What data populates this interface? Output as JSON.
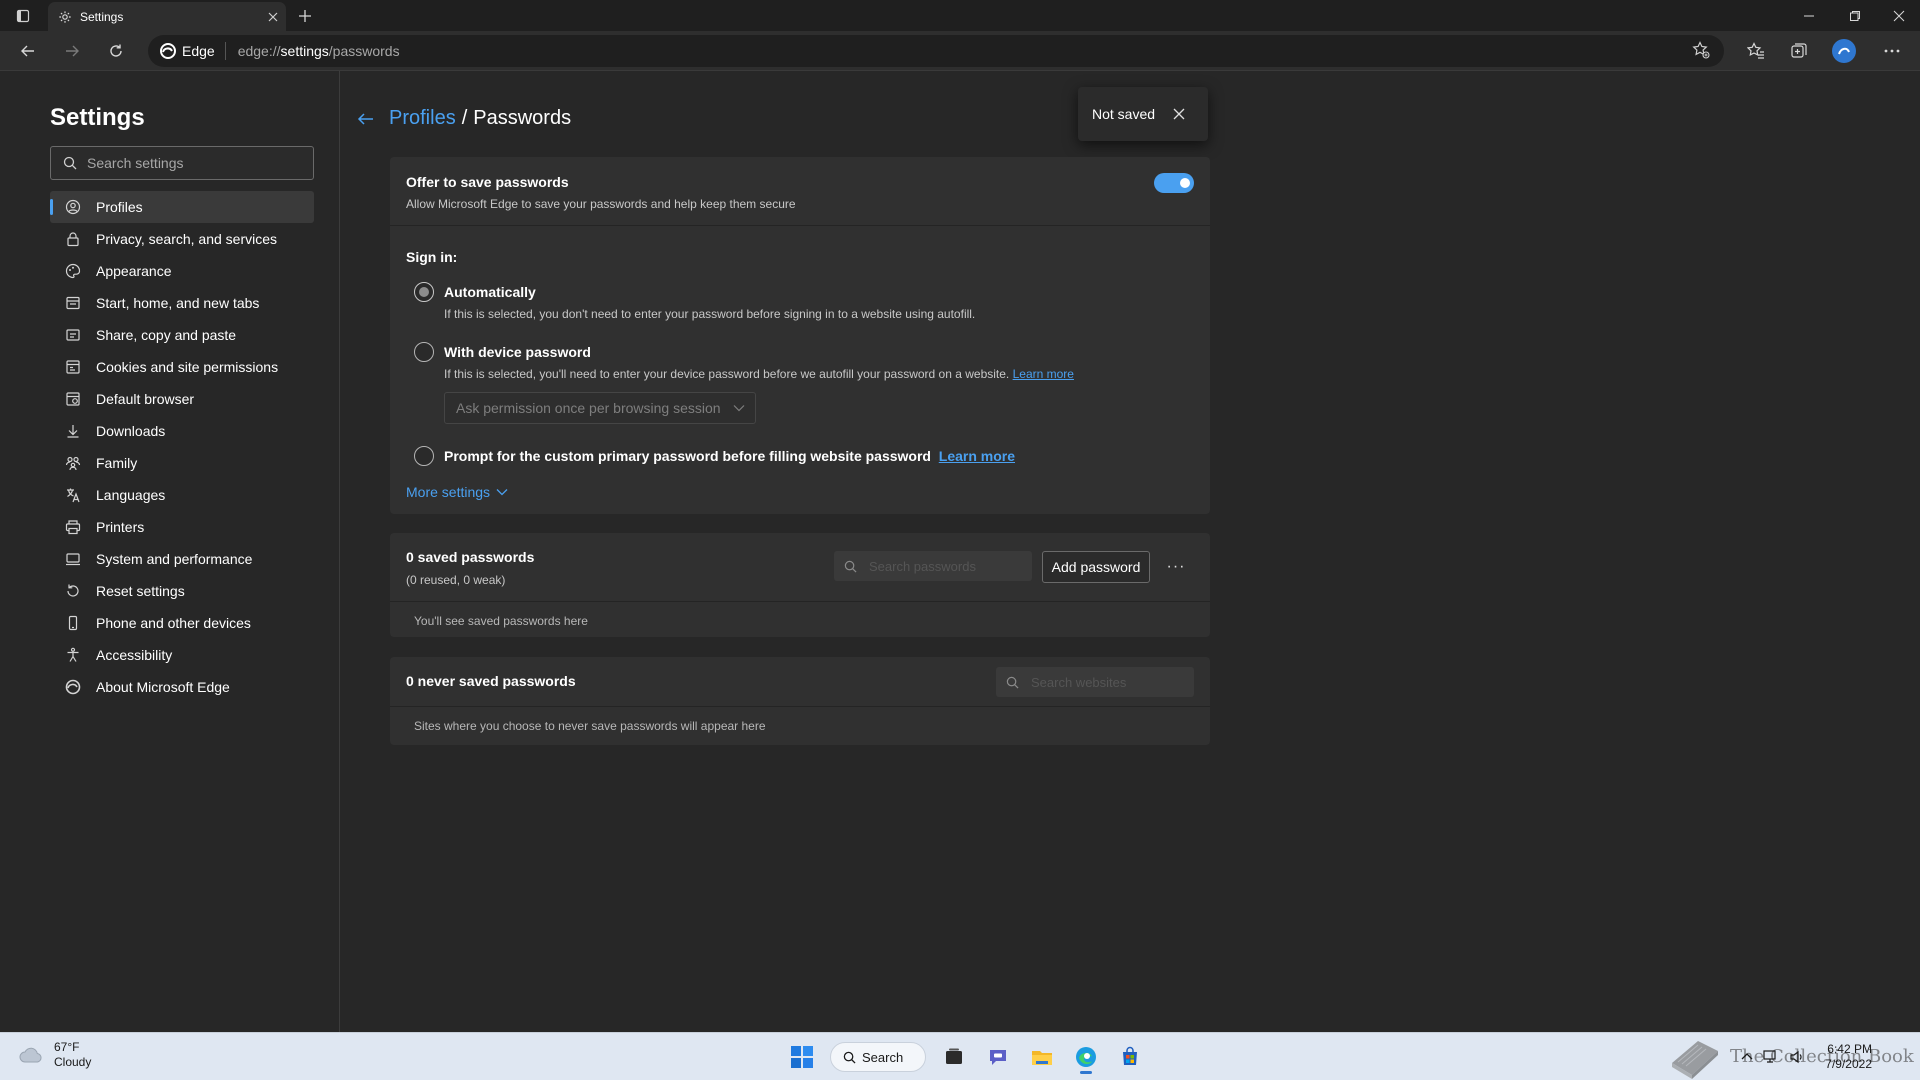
{
  "browser": {
    "tab_title": "Settings",
    "edge_label": "Edge",
    "url_scheme": "edge://",
    "url_host": "settings",
    "url_path": "/passwords"
  },
  "sidebar": {
    "title": "Settings",
    "search_placeholder": "Search settings",
    "items": [
      {
        "label": "Profiles",
        "icon": "profile-icon",
        "active": true
      },
      {
        "label": "Privacy, search, and services",
        "icon": "lock-icon"
      },
      {
        "label": "Appearance",
        "icon": "appearance-icon"
      },
      {
        "label": "Start, home, and new tabs",
        "icon": "home-tabs-icon"
      },
      {
        "label": "Share, copy and paste",
        "icon": "share-icon"
      },
      {
        "label": "Cookies and site permissions",
        "icon": "cookies-icon"
      },
      {
        "label": "Default browser",
        "icon": "browser-icon"
      },
      {
        "label": "Downloads",
        "icon": "download-icon"
      },
      {
        "label": "Family",
        "icon": "family-icon"
      },
      {
        "label": "Languages",
        "icon": "languages-icon"
      },
      {
        "label": "Printers",
        "icon": "printer-icon"
      },
      {
        "label": "System and performance",
        "icon": "system-icon"
      },
      {
        "label": "Reset settings",
        "icon": "reset-icon"
      },
      {
        "label": "Phone and other devices",
        "icon": "phone-icon"
      },
      {
        "label": "Accessibility",
        "icon": "accessibility-icon"
      },
      {
        "label": "About Microsoft Edge",
        "icon": "edge-icon"
      }
    ]
  },
  "breadcrumb": {
    "parent": "Profiles",
    "separator": "/",
    "current": "Passwords"
  },
  "toast": {
    "text": "Not saved"
  },
  "offer": {
    "title": "Offer to save passwords",
    "description": "Allow Microsoft Edge to save your passwords and help keep them secure",
    "enabled": true
  },
  "signin": {
    "label": "Sign in:",
    "options": [
      {
        "label": "Automatically",
        "description": "If this is selected, you don't need to enter your password before signing in to a website using autofill.",
        "checked": true
      },
      {
        "label": "With device password",
        "description": "If this is selected, you'll need to enter your device password before we autofill your password on a website.",
        "link": "Learn more",
        "checked": false
      },
      {
        "label": "Prompt for the custom primary password before filling website password",
        "link": "Learn more",
        "checked": false
      }
    ],
    "permission_select": "Ask permission once per browsing session",
    "more_settings": "More settings"
  },
  "saved": {
    "title": "0 saved passwords",
    "subtitle": "(0 reused, 0 weak)",
    "search_placeholder": "Search passwords",
    "add_button": "Add password",
    "more": "···",
    "empty": "You'll see saved passwords here"
  },
  "never_saved": {
    "title": "0 never saved passwords",
    "search_placeholder": "Search websites",
    "empty": "Sites where you choose to never save passwords will appear here"
  },
  "taskbar": {
    "weather_temp": "67°F",
    "weather_desc": "Cloudy",
    "search_label": "Search",
    "time": "6:42 PM",
    "date": "7/9/2022",
    "watermark": "The Collection Book"
  },
  "colors": {
    "accent": "#4aa0f0",
    "background": "#272727",
    "card": "#303030"
  }
}
